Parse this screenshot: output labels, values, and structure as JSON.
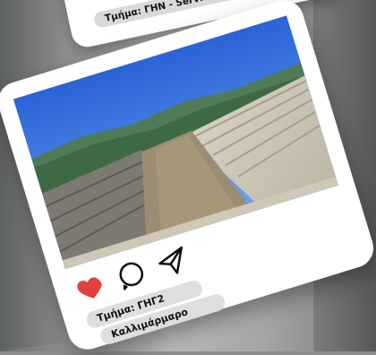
{
  "background": {
    "description_icon": "stadium-background-photo"
  },
  "back_card": {
    "pill_text": "Τμήμα: ΓΗΝ - Service Ci"
  },
  "main_card": {
    "photo_icon": "stadium-photo",
    "actions": [
      {
        "name": "like-icon",
        "color": "#e2403c"
      },
      {
        "name": "comment-icon",
        "color": "#111111"
      },
      {
        "name": "share-icon",
        "color": "#111111"
      }
    ],
    "department": "Τμήμα: ΓΗΓ2",
    "place": "Καλλιμάρμαρο"
  },
  "colors": {
    "heart": "#e2403c",
    "card": "#ffffff",
    "pill": "#dedede"
  }
}
